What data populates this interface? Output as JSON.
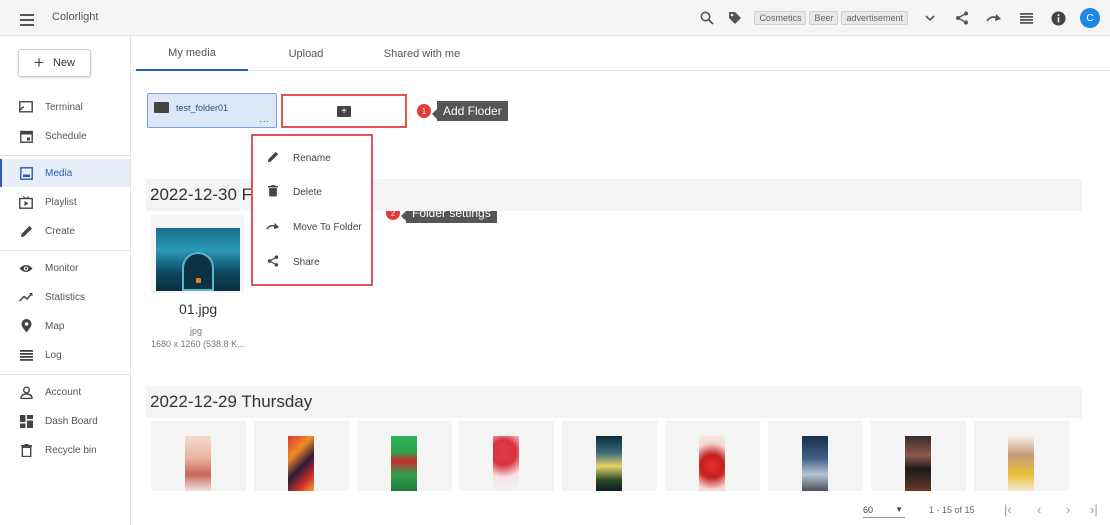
{
  "app": {
    "title": "Colorlight"
  },
  "topbar": {
    "tags": [
      "Cosmetics",
      "Beer",
      "advertisement"
    ],
    "avatar_letter": "C",
    "icons": [
      "search-icon",
      "tag-icon",
      "chevron-down-icon",
      "share-icon",
      "move-icon",
      "list-icon",
      "info-icon"
    ]
  },
  "sidebar": {
    "new_label": "New",
    "items": [
      {
        "label": "Terminal",
        "icon": "terminal-icon"
      },
      {
        "label": "Schedule",
        "icon": "schedule-icon"
      },
      {
        "label": "Media",
        "icon": "media-icon",
        "active": true
      },
      {
        "label": "Playlist",
        "icon": "playlist-icon"
      },
      {
        "label": "Create",
        "icon": "pencil-icon"
      },
      {
        "label": "Monitor",
        "icon": "eye-icon"
      },
      {
        "label": "Statistics",
        "icon": "trend-icon"
      },
      {
        "label": "Map",
        "icon": "map-pin-icon"
      },
      {
        "label": "Log",
        "icon": "log-icon"
      },
      {
        "label": "Account",
        "icon": "user-icon"
      },
      {
        "label": "Dash Board",
        "icon": "dashboard-icon"
      },
      {
        "label": "Recycle bin",
        "icon": "trash-icon"
      }
    ]
  },
  "tabs": [
    "My media",
    "Upload",
    "Shared with me"
  ],
  "folder": {
    "name": "test_folder01",
    "more": "..."
  },
  "callouts": [
    {
      "num": "1",
      "text": "Add Floder"
    },
    {
      "num": "2",
      "text": "Folder settings"
    }
  ],
  "context_menu": [
    "Rename",
    "Delete",
    "Move To Folder",
    "Share"
  ],
  "groups": [
    {
      "date": "2022-12-30 F"
    },
    {
      "date": "2022-12-29 Thursday"
    }
  ],
  "file": {
    "name": "01.jpg",
    "type": "jpg",
    "size": "1680 x 1260 (538.8 K..."
  },
  "pagination": {
    "page_size": "60",
    "range": "1 - 15 of 15"
  },
  "colors": {
    "accent": "#2b5cb8",
    "callout_red": "#e53935",
    "highlight_border": "#e05555"
  }
}
